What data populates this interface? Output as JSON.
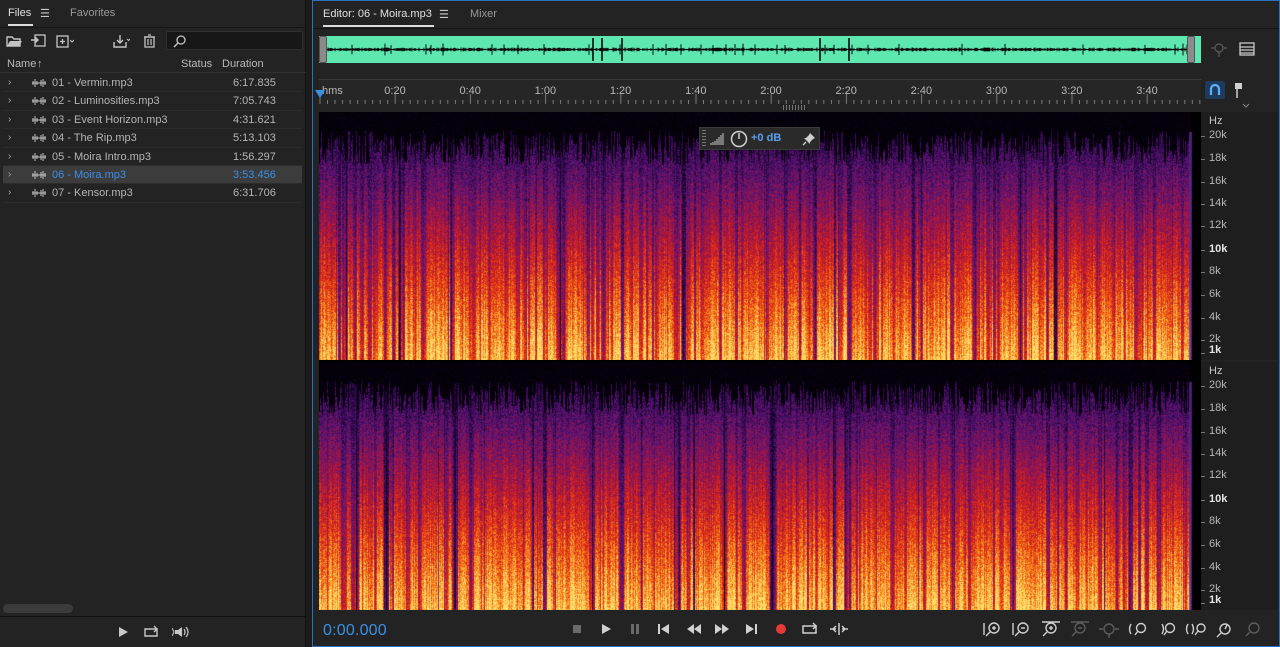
{
  "files_panel": {
    "tabs": [
      {
        "label": "Files",
        "active": true
      },
      {
        "label": "Favorites",
        "active": false
      }
    ],
    "search": {
      "value": "",
      "placeholder": ""
    },
    "columns": {
      "name": "Name",
      "sort_indicator": "↑",
      "status": "Status",
      "duration": "Duration"
    },
    "files": [
      {
        "name": "01 - Vermin.mp3",
        "status": "",
        "duration": "6:17.835",
        "selected": false
      },
      {
        "name": "02 - Luminosities.mp3",
        "status": "",
        "duration": "7:05.743",
        "selected": false
      },
      {
        "name": "03 - Event Horizon.mp3",
        "status": "",
        "duration": "4:31.621",
        "selected": false
      },
      {
        "name": "04 - The Rip.mp3",
        "status": "",
        "duration": "5:13.103",
        "selected": false
      },
      {
        "name": "05 - Moira Intro.mp3",
        "status": "",
        "duration": "1:56.297",
        "selected": false
      },
      {
        "name": "06 - Moira.mp3",
        "status": "",
        "duration": "3:53.456",
        "selected": true
      },
      {
        "name": "07 - Kensor.mp3",
        "status": "",
        "duration": "6:31.706",
        "selected": false
      }
    ]
  },
  "editor": {
    "tabs": [
      {
        "label": "Editor: 06 - Moira.mp3",
        "active": true
      },
      {
        "label": "Mixer",
        "active": false
      }
    ],
    "ruler": {
      "unit": "hms",
      "labels": [
        "0:20",
        "0:40",
        "1:00",
        "1:20",
        "1:40",
        "2:00",
        "2:20",
        "2:40",
        "3:00",
        "3:20",
        "3:40"
      ]
    },
    "hud": {
      "volume": "+0 dB"
    },
    "frequency_scale": {
      "unit": "Hz",
      "labels": [
        "20k",
        "18k",
        "16k",
        "14k",
        "12k",
        "10k",
        "8k",
        "6k",
        "4k",
        "2k",
        "1k"
      ]
    },
    "current_time": "0:00.000",
    "colors": {
      "accent": "#3b8fe6",
      "overview_waveform": "#5ee8b0",
      "record": "#e53935"
    }
  }
}
